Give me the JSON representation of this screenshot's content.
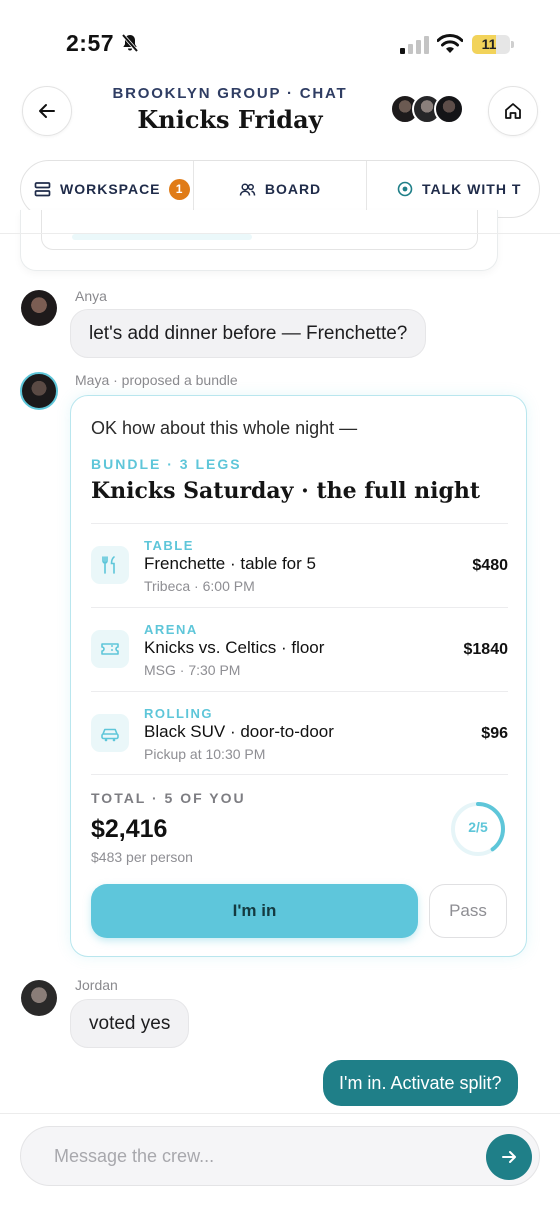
{
  "status_bar": {
    "time": "2:57",
    "battery": "11",
    "battery_level": 0.11,
    "icons": [
      "bell-slash-icon",
      "signal-icon",
      "wifi-icon",
      "battery-icon"
    ]
  },
  "header": {
    "subtitle": "BROOKLYN GROUP · CHAT",
    "title": "Knicks Friday",
    "back_icon": "arrow-left-icon",
    "home_icon": "home-icon",
    "participant_count_shown": 3
  },
  "tabs": [
    {
      "label": "WORKSPACE",
      "icon": "layers-icon",
      "badge": "1"
    },
    {
      "label": "BOARD",
      "icon": "people-icon"
    },
    {
      "label": "TALK WITH T",
      "icon": "target-icon"
    }
  ],
  "messages": {
    "anya": {
      "sender": "Anya",
      "text": "let's add dinner before — Frenchette?"
    },
    "maya": {
      "sender": "Maya · proposed a bundle",
      "intro": "OK how about this whole night —",
      "bundle": {
        "label": "BUNDLE · 3 LEGS",
        "title": "Knicks Saturday · the full night",
        "legs": [
          {
            "category": "TABLE",
            "name": "Frenchette · table for 5",
            "meta": "Tribeca · 6:00 PM",
            "price": "$480",
            "icon": "utensils-icon"
          },
          {
            "category": "ARENA",
            "name": "Knicks vs. Celtics · floor",
            "meta": "MSG · 7:30 PM",
            "price": "$1840",
            "icon": "ticket-icon"
          },
          {
            "category": "ROLLING",
            "name": "Black SUV · door-to-door",
            "meta": "Pickup at 10:30 PM",
            "price": "$96",
            "icon": "car-icon"
          }
        ],
        "total_label": "TOTAL · 5 OF YOU",
        "total": "$2,416",
        "per_person": "$483 per person",
        "votes": "2/5",
        "votes_fraction": 0.4,
        "primary_button": "I'm in",
        "secondary_button": "Pass"
      }
    },
    "jordan": {
      "sender": "Jordan",
      "text": "voted yes"
    },
    "outgoing": {
      "text": "I'm in. Activate split?"
    }
  },
  "composer": {
    "placeholder": "Message the crew...",
    "send_icon": "arrow-right-icon"
  },
  "colors": {
    "accent": "#5ec6d9",
    "teal_dark": "#1f7f88",
    "navy": "#2f3d63",
    "badge": "#e07b17"
  }
}
